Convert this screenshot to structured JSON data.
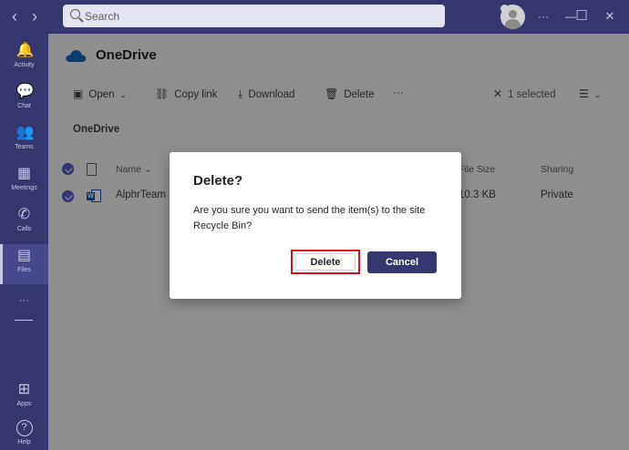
{
  "window": {
    "search_placeholder": "Search",
    "back_glyph": "‹",
    "forward_glyph": "›",
    "more_glyph": "···",
    "minimize_glyph": "—",
    "maximize_glyph": "☐",
    "close_glyph": "✕"
  },
  "rail": {
    "items": [
      {
        "label": "Activity",
        "icon": "bell-icon",
        "glyph": "🔔"
      },
      {
        "label": "Chat",
        "icon": "chat-icon",
        "glyph": "💬"
      },
      {
        "label": "Teams",
        "icon": "teams-icon",
        "glyph": "👥"
      },
      {
        "label": "Meetings",
        "icon": "calendar-icon",
        "glyph": "▦"
      },
      {
        "label": "Calls",
        "icon": "phone-icon",
        "glyph": "✆"
      },
      {
        "label": "Files",
        "icon": "file-icon",
        "glyph": "▤"
      }
    ],
    "more_glyph": "···",
    "apps_label": "Apps",
    "apps_glyph": "⊞",
    "help_label": "Help",
    "help_glyph": "?"
  },
  "header": {
    "title": "OneDrive"
  },
  "commands": {
    "open": "Open",
    "copy_link": "Copy link",
    "download": "Download",
    "delete": "Delete",
    "more": "···",
    "selected": "1 selected"
  },
  "breadcrumb": "OneDrive",
  "table": {
    "columns": {
      "name": "Name",
      "file_size": "File Size",
      "sharing": "Sharing"
    },
    "rows": [
      {
        "name": "AlphrTeam",
        "file_size": "10.3 KB",
        "sharing": "Private"
      }
    ]
  },
  "dialog": {
    "title": "Delete?",
    "message": "Are you sure you want to send the item(s) to the site Recycle Bin?",
    "confirm_label": "Delete",
    "cancel_label": "Cancel"
  },
  "colors": {
    "brand": "#35376e",
    "accent": "#5b5fc7",
    "highlight": "#d1141b"
  }
}
